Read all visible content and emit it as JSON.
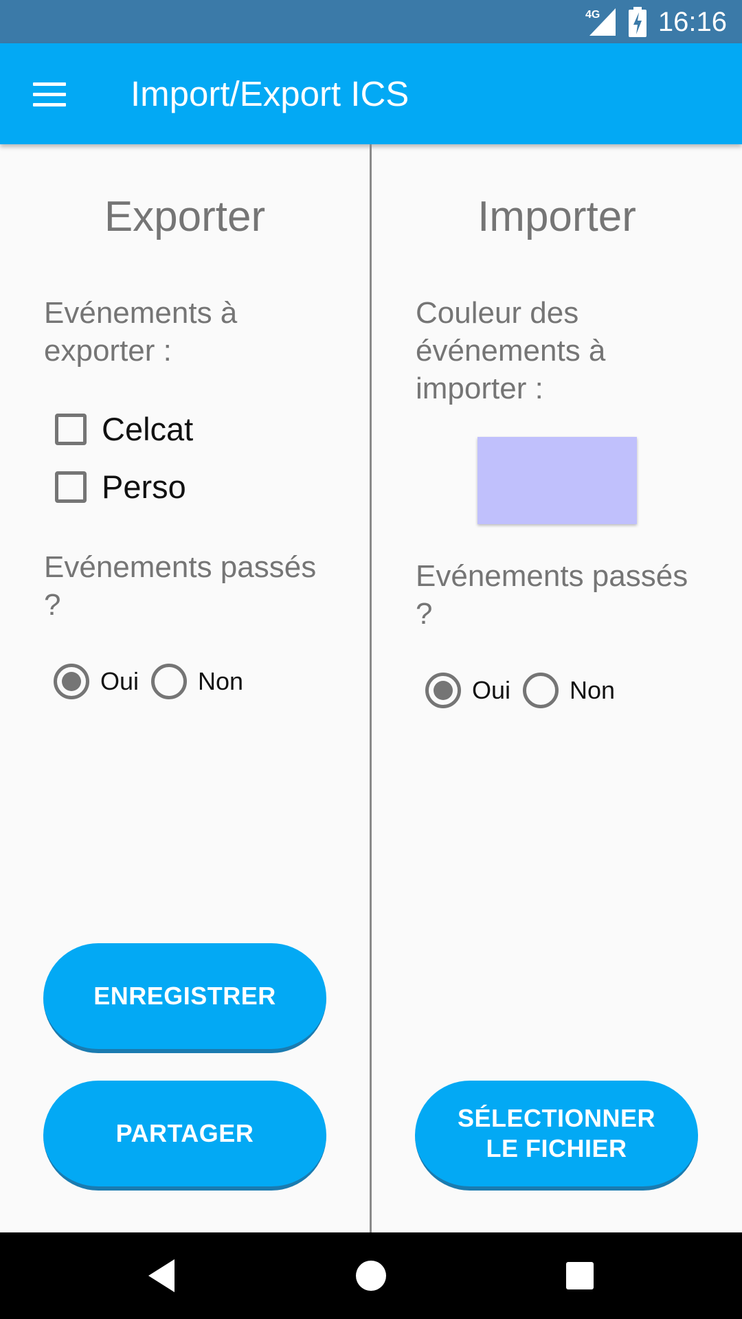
{
  "status_bar": {
    "network": "4G",
    "time": "16:16"
  },
  "app_bar": {
    "title": "Import/Export ICS"
  },
  "export_panel": {
    "heading": "Exporter",
    "events_label": "Evénements à exporter :",
    "checkboxes": [
      {
        "label": "Celcat",
        "checked": false
      },
      {
        "label": "Perso",
        "checked": false
      }
    ],
    "past_label": "Evénements passés ?",
    "radio_yes": "Oui",
    "radio_no": "Non",
    "selected": "Oui",
    "save_button": "ENREGISTRER",
    "share_button": "PARTAGER"
  },
  "import_panel": {
    "heading": "Importer",
    "color_label": "Couleur des événements à importer :",
    "swatch_color": "#c0c0fc",
    "past_label": "Evénements passés ?",
    "radio_yes": "Oui",
    "radio_no": "Non",
    "selected": "Oui",
    "select_file_button": "SÉLECTIONNER LE FICHIER"
  },
  "colors": {
    "status_bar": "#3b7aa8",
    "accent": "#03a9f4"
  }
}
